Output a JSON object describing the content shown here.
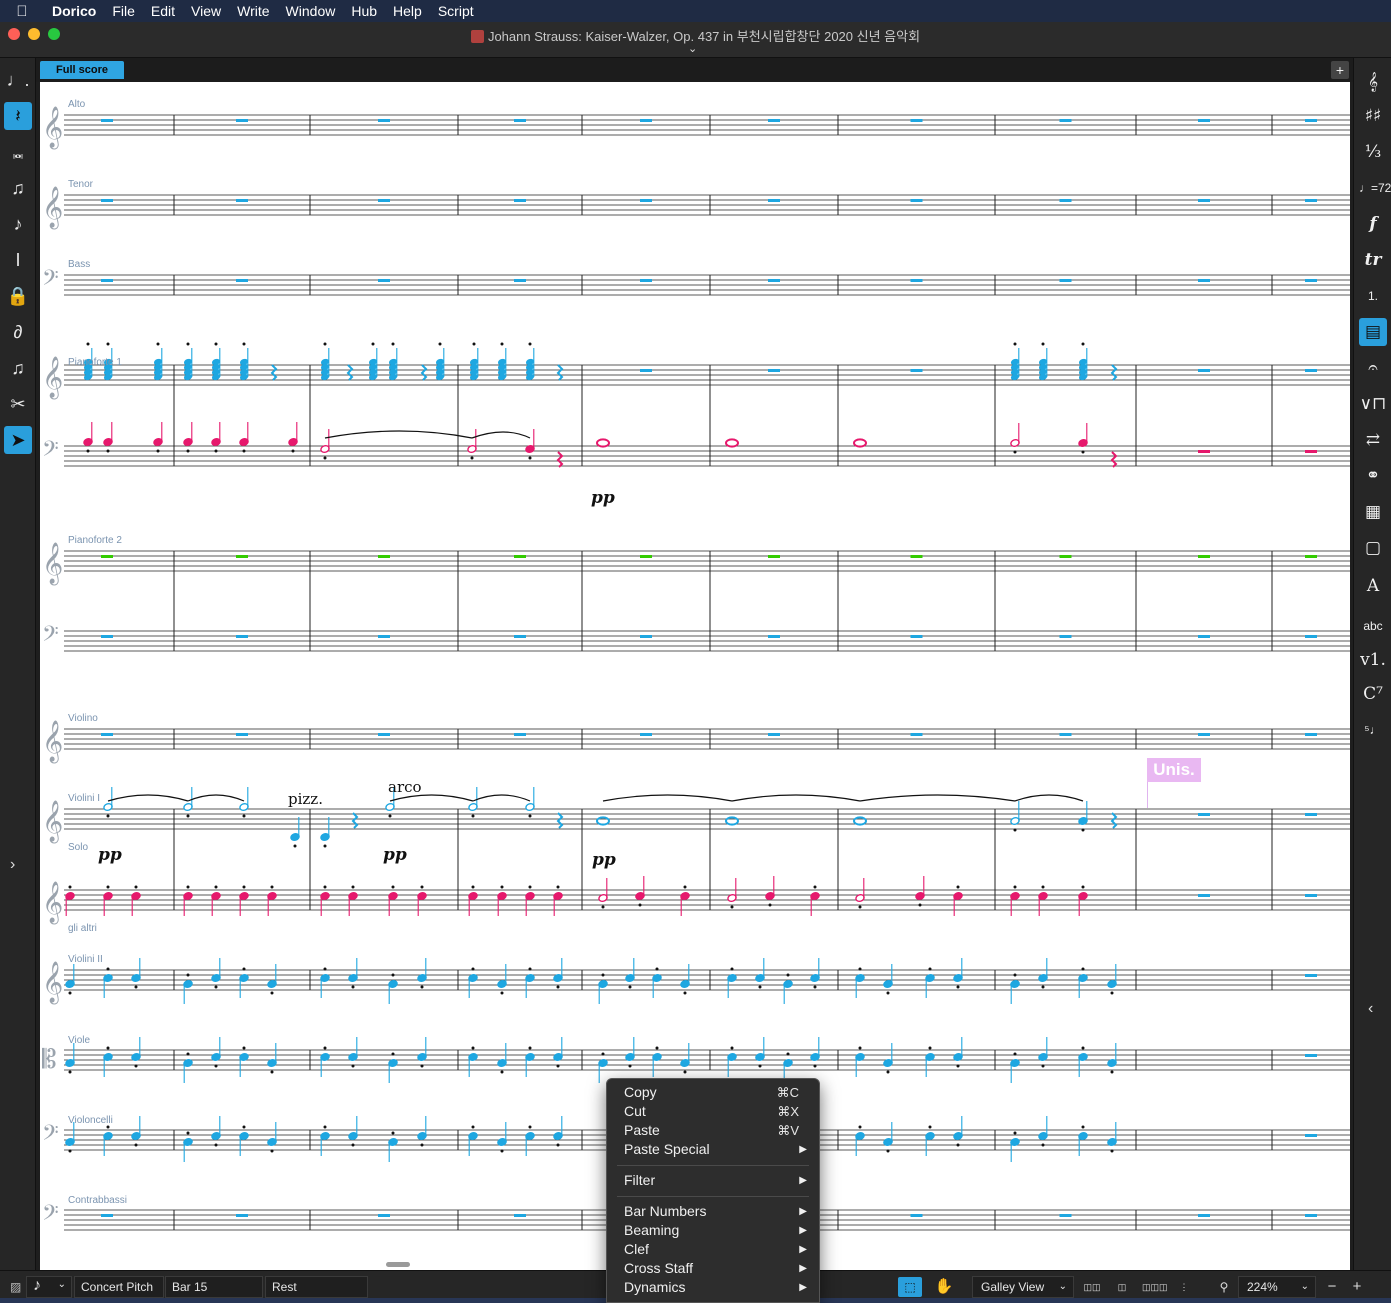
{
  "menubar": {
    "apple_icon": "apple-logo",
    "items": [
      "Dorico",
      "File",
      "Edit",
      "View",
      "Write",
      "Window",
      "Hub",
      "Help",
      "Script"
    ]
  },
  "window": {
    "title": "Johann Strauss: Kaiser-Walzer, Op. 437 in 부천시립합창단 2020 신년 음악회"
  },
  "tabs": {
    "active": "Full score",
    "add": "+"
  },
  "score": {
    "instruments": [
      {
        "key": "alto",
        "label": "Alto"
      },
      {
        "key": "tenor",
        "label": "Tenor"
      },
      {
        "key": "bass",
        "label": "Bass"
      },
      {
        "key": "pf1",
        "label": "Pianoforte 1"
      },
      {
        "key": "pf2",
        "label": "Pianoforte 2"
      },
      {
        "key": "violino",
        "label": "Violino"
      },
      {
        "key": "vln1",
        "label": "Violini I"
      },
      {
        "key": "vln1solo",
        "label": "Solo"
      },
      {
        "key": "vln1altri",
        "label": "gli altri"
      },
      {
        "key": "vln2",
        "label": "Violini II"
      },
      {
        "key": "viole",
        "label": "Viole"
      },
      {
        "key": "vc",
        "label": "Violoncelli"
      },
      {
        "key": "cb",
        "label": "Contrabbassi"
      }
    ],
    "dynamics": {
      "pf_pp": "pp",
      "solo_pp1": "pp",
      "solo_pp2": "pp",
      "solo_pp3": "pp"
    },
    "techniques": {
      "pizz": "pizz.",
      "arco": "arco",
      "unis": "Unis."
    },
    "colors": {
      "selected": "#1ea7e1",
      "voice2": "#e6186c",
      "rest_highlight": "#33cc00",
      "unis_flag": "#e9b8f2",
      "label": "#7b94b0"
    }
  },
  "statusbar": {
    "concert_pitch": "Concert Pitch",
    "bar": "Bar 15",
    "selection": "Rest",
    "view_mode": "Galley View",
    "zoom": "224%",
    "zoom_minus": "−",
    "zoom_plus": "+"
  },
  "context_menu": {
    "items": [
      {
        "label": "Copy",
        "shortcut": "⌘C"
      },
      {
        "label": "Cut",
        "shortcut": "⌘X"
      },
      {
        "label": "Paste",
        "shortcut": "⌘V"
      },
      {
        "label": "Paste Special",
        "submenu": true
      },
      {
        "label": "Filter",
        "submenu": true
      },
      {
        "label": "Bar Numbers",
        "submenu": true
      },
      {
        "label": "Beaming",
        "submenu": true
      },
      {
        "label": "Clef",
        "submenu": true
      },
      {
        "label": "Cross Staff",
        "submenu": true
      },
      {
        "label": "Dynamics",
        "submenu": true
      }
    ]
  },
  "left_tools": [
    "dotted-quarter-note-icon",
    "rest-icon",
    "slash-note-icon",
    "grace-note-icon",
    "grace-note-slash-icon",
    "insert-mode-icon",
    "lock-duration-icon",
    "caret-icon",
    "chord-icon",
    "scissors-icon",
    "pointer-icon"
  ],
  "right_tools": [
    "treble-clef-icon",
    "key-signature-icon",
    "time-signature-icon",
    "tempo-icon",
    "dynamics-icon",
    "ornaments-icon",
    "repeat-ending-icon",
    "playing-techniques-icon",
    "holds-pauses-icon",
    "bow-icon",
    "repeat-markers-icon",
    "ear-icon",
    "clapper-icon",
    "comment-icon",
    "text-icon",
    "lyrics-icon",
    "version-icon",
    "chord-symbols-icon",
    "figured-bass-icon"
  ]
}
